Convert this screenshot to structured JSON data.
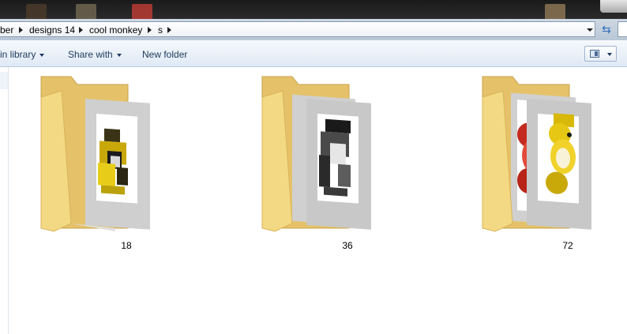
{
  "address_bar": {
    "crumbs": [
      "ber",
      "designs 14",
      "cool monkey",
      "s"
    ]
  },
  "command_bar": {
    "include_in_library_label": "in library",
    "share_with_label": "Share with",
    "new_folder_label": "New folder"
  },
  "items": [
    {
      "name": "18",
      "thumb_color": "yellow-pixelated-monkey-icon"
    },
    {
      "name": "36",
      "thumb_color": "gray-pixelated-monkey-icon"
    },
    {
      "name": "72",
      "thumb_color": "red-yellow-monkey-icon"
    }
  ],
  "colors": {
    "folder_back": "#e9c46a",
    "folder_front": "#f6dc8c",
    "accent": "#1e395b"
  }
}
